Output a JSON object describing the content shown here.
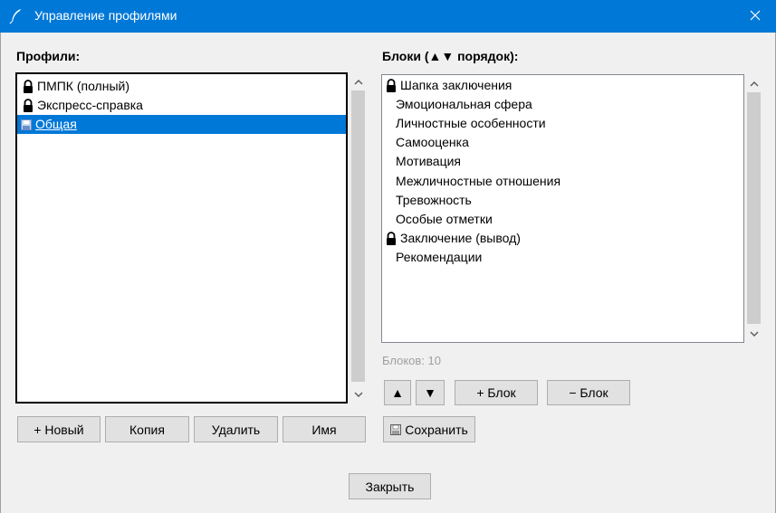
{
  "window": {
    "title": "Управление профилями"
  },
  "profiles": {
    "label": "Профили:",
    "items": [
      {
        "label": "ПМПК (полный)",
        "icon": "lock-icon"
      },
      {
        "label": "Экспресс-справка",
        "icon": "lock-icon"
      },
      {
        "label": "Общая",
        "icon": "disk-icon",
        "selected": true
      }
    ],
    "buttons": {
      "new": "+ Новый",
      "copy": "Копия",
      "delete": "Удалить",
      "rename": "Имя"
    }
  },
  "blocks": {
    "label": "Блоки (▲▼ порядок):",
    "items": [
      {
        "label": "Шапка заключения",
        "locked": true
      },
      {
        "label": "Эмоциональная сфера",
        "locked": false
      },
      {
        "label": "Личностные особенности",
        "locked": false
      },
      {
        "label": "Самооценка",
        "locked": false
      },
      {
        "label": "Мотивация",
        "locked": false
      },
      {
        "label": "Межличностные отношения",
        "locked": false
      },
      {
        "label": "Тревожность",
        "locked": false
      },
      {
        "label": "Особые отметки",
        "locked": false
      },
      {
        "label": "Заключение (вывод)",
        "locked": true
      },
      {
        "label": "Рекомендации",
        "locked": false
      }
    ],
    "count_text": "Блоков: 10",
    "buttons": {
      "up": "▲",
      "down": "▼",
      "add": "+ Блок",
      "remove": "− Блок",
      "save": "Сохранить"
    }
  },
  "footer": {
    "close": "Закрыть"
  }
}
